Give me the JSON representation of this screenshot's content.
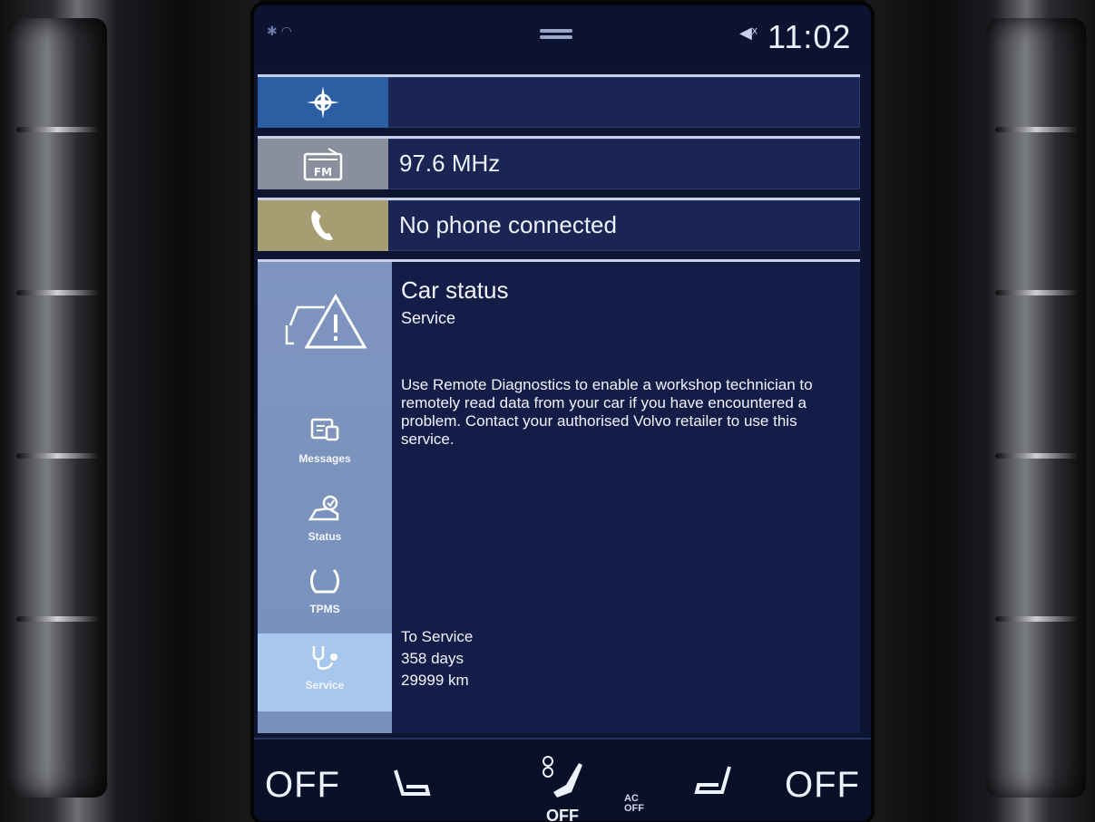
{
  "status_bar": {
    "time": "11:02",
    "mute_icon": "speaker-muted-icon"
  },
  "tiles": {
    "navigation": {
      "icon": "compass-icon",
      "text": ""
    },
    "radio": {
      "icon": "fm-radio-icon",
      "text": "97.6 MHz"
    },
    "phone": {
      "icon": "phone-handset-icon",
      "text": "No phone connected"
    }
  },
  "car_status": {
    "title": "Car status",
    "subtitle": "Service",
    "body": "Use Remote Diagnostics to enable a workshop technician to remotely read data from your car if you have encountered a problem. Contact your authorised Volvo retailer to use this service.",
    "to_service_label": "To Service",
    "to_service_days": "358 days",
    "to_service_km": "29999 km",
    "sidebar": [
      {
        "label": "Messages",
        "icon": "messages-icon",
        "active": false
      },
      {
        "label": "Status",
        "icon": "status-icon",
        "active": false
      },
      {
        "label": "TPMS",
        "icon": "tire-pressure-icon",
        "active": false
      },
      {
        "label": "Service",
        "icon": "service-stethoscope-icon",
        "active": true
      }
    ]
  },
  "climate": {
    "left_temp": "OFF",
    "right_temp": "OFF",
    "center_fan": "OFF",
    "ac": "AC\nOFF"
  },
  "colors": {
    "nav_tile": "#2c5ea3",
    "radio_tile": "#8a8f9d",
    "phone_tile": "#a79d72",
    "sidebar": "#7f95bf",
    "sidebar_active": "#a8c7ec",
    "screen_bg": "#141d48"
  }
}
